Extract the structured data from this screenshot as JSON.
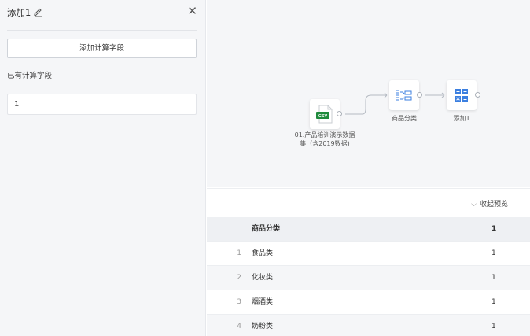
{
  "panel": {
    "title": "添加1",
    "close_label": "✕",
    "add_button_label": "添加计算字段",
    "section_label": "已有计算字段",
    "fields": [
      "1"
    ]
  },
  "canvas": {
    "nodes": [
      {
        "icon": "csv-file-icon",
        "badge": "CSV",
        "label_line1": "01.产品培训演示数据",
        "label_line2": "集（含2019数据)"
      },
      {
        "icon": "category-transform-icon",
        "label_line1": "商品分类"
      },
      {
        "icon": "add-calc-icon",
        "label_line1": "添加1"
      }
    ]
  },
  "preview": {
    "collapse_label": "收起预览",
    "columns": [
      "商品分类",
      "1"
    ],
    "rows": [
      {
        "index": "1",
        "category": "食品类",
        "value": "1"
      },
      {
        "index": "2",
        "category": "化妆类",
        "value": "1"
      },
      {
        "index": "3",
        "category": "烟酒类",
        "value": "1"
      },
      {
        "index": "4",
        "category": "奶粉类",
        "value": "1"
      }
    ]
  },
  "colors": {
    "csv_badge": "#1f8a3c",
    "calc_icon": "#3b7fe0",
    "panel_bg": "#f5f6f8"
  }
}
